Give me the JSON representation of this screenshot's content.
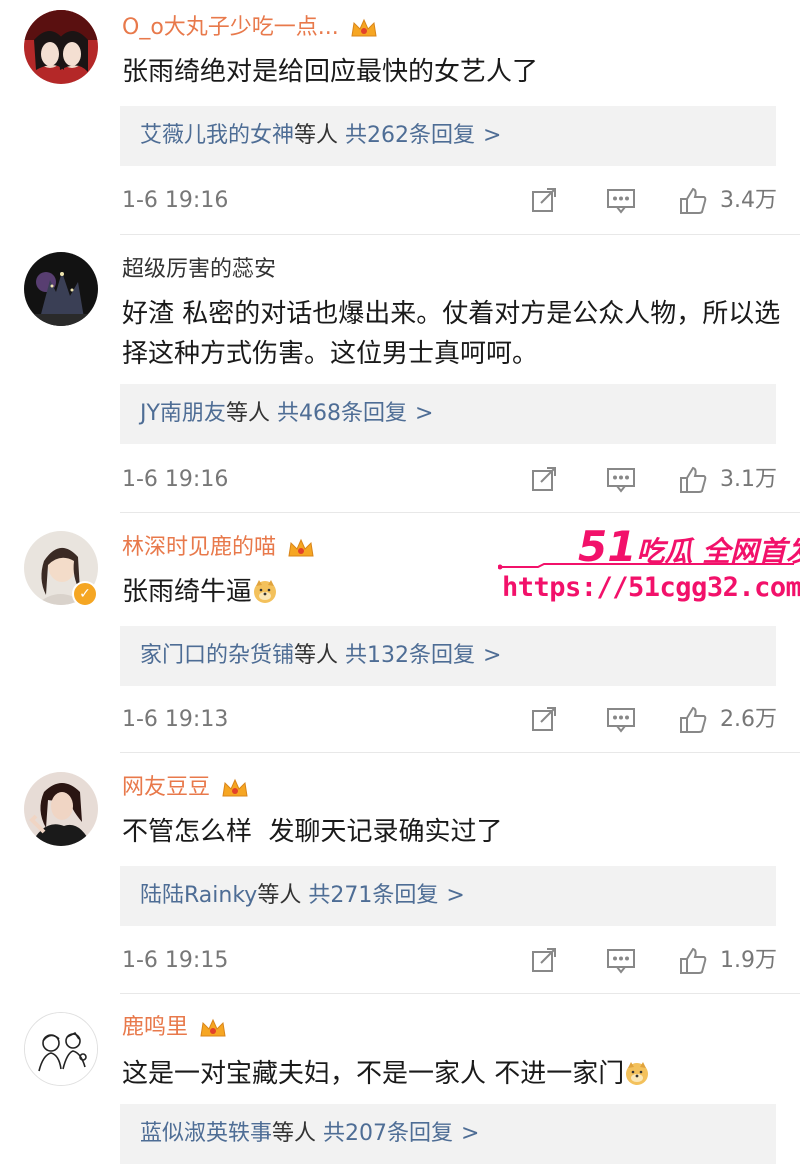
{
  "comments": [
    {
      "username": "O_o大丸子少吃一点...",
      "vip": true,
      "text": "张雨绮绝对是给回应最快的女艺人了",
      "replies_names": "艾薇儿我的女神",
      "replies_etc": "等人",
      "replies_count": "共262条回复",
      "arrow": ">",
      "time": "1-6 19:16",
      "likes": "3.4万"
    },
    {
      "username": "超级厉害的蕊安",
      "vip": false,
      "text": "好渣 私密的对话也爆出来。仗着对方是公众人物，所以选择这种方式伤害。这位男士真呵呵。",
      "replies_names": "JY南朋友",
      "replies_etc": "等人",
      "replies_count": "共468条回复",
      "arrow": ">",
      "time": "1-6 19:16",
      "likes": "3.1万"
    },
    {
      "username": "林深时见鹿的喵",
      "vip": true,
      "text": "张雨绮牛逼",
      "replies_names": "家门口的杂货铺",
      "replies_etc": "等人",
      "replies_count": "共132条回复",
      "arrow": ">",
      "time": "1-6 19:13",
      "likes": "2.6万"
    },
    {
      "username": "网友豆豆",
      "vip": true,
      "text": "不管怎么样  发聊天记录确实过了",
      "replies_names": "陆陆Rainky",
      "replies_etc": "等人",
      "replies_count": "共271条回复",
      "arrow": ">",
      "time": "1-6 19:15",
      "likes": "1.9万"
    },
    {
      "username": "鹿鸣里",
      "vip": true,
      "text": "这是一对宝藏夫妇，不是一家人 不进一家门",
      "replies_names": "蓝似淑英轶事",
      "replies_etc": "等人",
      "replies_count": "共207条回复",
      "arrow": ">"
    }
  ],
  "watermark": {
    "brand_num": "51",
    "brand_text": "吃瓜 全网首发",
    "url": "https://51cgg32.com"
  },
  "colors": {
    "vip_name": "#e8794b",
    "reply_link": "#4e6d95",
    "watermark": "#f2116a"
  },
  "icons": [
    "crown-icon",
    "share-icon",
    "comment-icon",
    "like-icon",
    "doge-emoji",
    "verified-icon"
  ]
}
